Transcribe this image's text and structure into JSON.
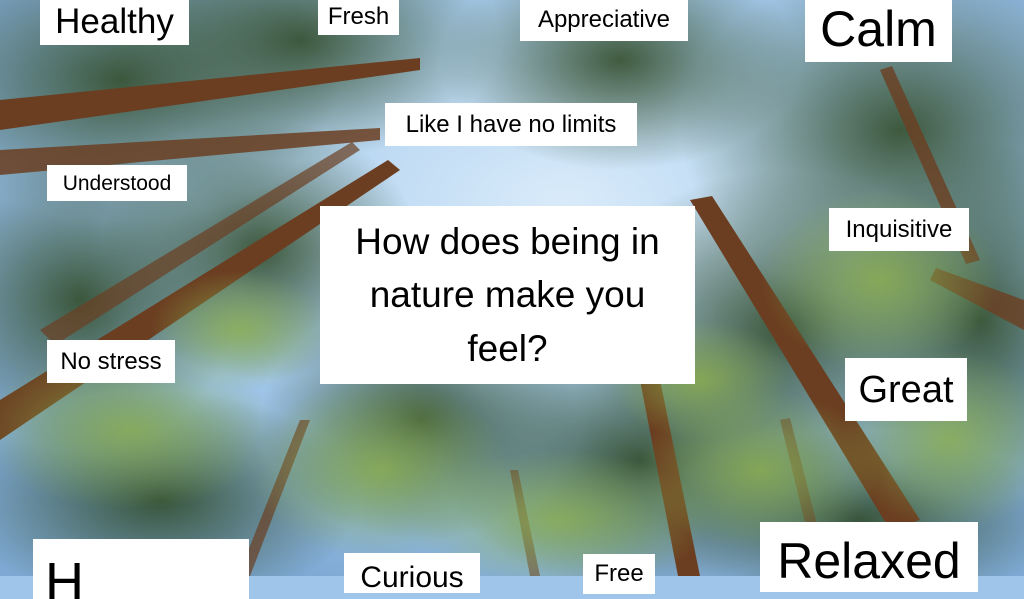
{
  "question": "How does being in nature make you feel?",
  "words": {
    "healthy": "Healthy",
    "fresh": "Fresh",
    "appreciative": "Appreciative",
    "calm": "Calm",
    "no_limits": "Like I have no limits",
    "understood": "Understood",
    "inquisitive": "Inquisitive",
    "no_stress": "No stress",
    "great": "Great",
    "happy_partial": "H",
    "curious": "Curious",
    "free": "Free",
    "relaxed": "Relaxed"
  },
  "colors": {
    "sky": "#9fc6ea",
    "foliage_dark": "#2f4a22",
    "foliage_light": "#8fb34a",
    "trunk": "#6b3e22",
    "label_bg": "#ffffff",
    "label_text": "#000000"
  }
}
